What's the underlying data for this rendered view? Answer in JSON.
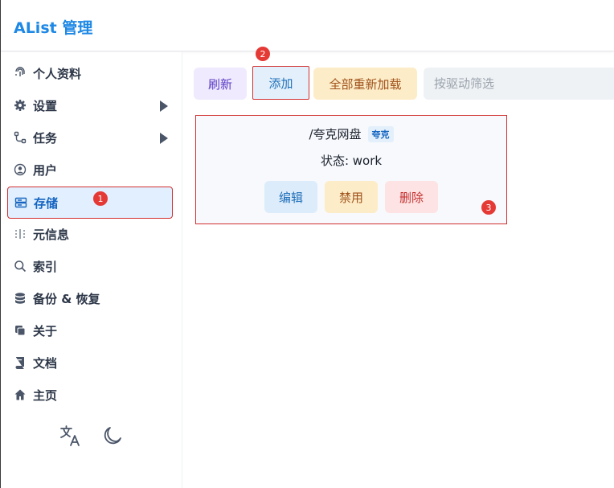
{
  "app": {
    "title": "AList 管理"
  },
  "sidebar": {
    "items": [
      {
        "label": "个人资料",
        "icon": "fingerprint-icon"
      },
      {
        "label": "设置",
        "icon": "gear-icon",
        "has_children": true
      },
      {
        "label": "任务",
        "icon": "flow-icon",
        "has_children": true
      },
      {
        "label": "用户",
        "icon": "user-circle-icon"
      },
      {
        "label": "存储",
        "icon": "storage-icon",
        "active": true
      },
      {
        "label": "元信息",
        "icon": "meta-icon"
      },
      {
        "label": "索引",
        "icon": "search-icon"
      },
      {
        "label": "备份 & 恢复",
        "icon": "database-icon"
      },
      {
        "label": "关于",
        "icon": "copy-icon"
      },
      {
        "label": "文档",
        "icon": "book-icon"
      },
      {
        "label": "主页",
        "icon": "home-icon"
      }
    ],
    "footer": {
      "language_icon": "translate-icon",
      "theme_icon": "moon-icon"
    }
  },
  "toolbar": {
    "refresh_label": "刷新",
    "add_label": "添加",
    "reload_all_label": "全部重新加载",
    "filter_placeholder": "按驱动筛选"
  },
  "storage_card": {
    "mount_path": "/夸克网盘",
    "driver_tag": "夸克",
    "status": "状态: work",
    "edit_label": "编辑",
    "disable_label": "禁用",
    "delete_label": "删除"
  },
  "annotations": {
    "badge_1": "1",
    "badge_2": "2",
    "badge_3": "3"
  },
  "colors": {
    "accent": "#1e88e5",
    "highlight_border": "#d32f2f",
    "badge": "#e53935"
  }
}
